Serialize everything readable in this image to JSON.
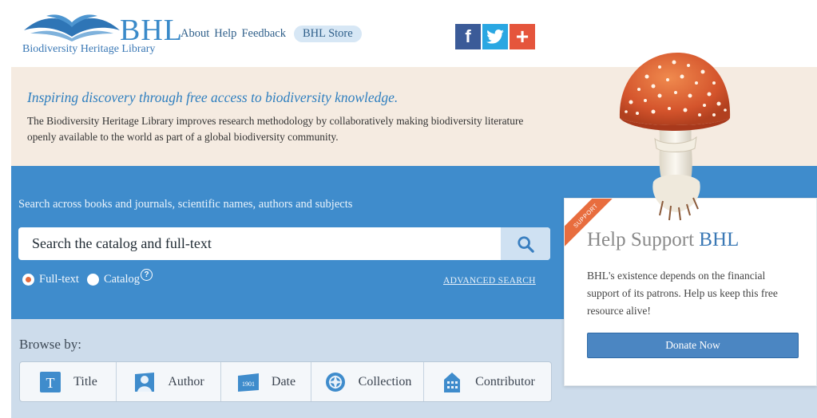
{
  "header": {
    "logo_text": "BHL",
    "logo_subtitle": "Biodiversity Heritage Library",
    "nav": {
      "about": "About",
      "help": "Help",
      "feedback": "Feedback",
      "store": "BHL Store"
    },
    "social": {
      "facebook": "f",
      "twitter_icon": "twitter-icon",
      "plus": "+"
    }
  },
  "banner": {
    "tagline": "Inspiring discovery through free access to biodiversity knowledge.",
    "description": "The Biodiversity Heritage Library improves research methodology by collaboratively making biodiversity literature openly available to the world as part of a global biodiversity community."
  },
  "search": {
    "caption": "Search across books and journals, scientific names, authors and subjects",
    "placeholder": "Search the catalog and full-text",
    "options": [
      {
        "label": "Full-text",
        "checked": true
      },
      {
        "label": "Catalog",
        "checked": false
      }
    ],
    "help_glyph": "?",
    "advanced": "ADVANCED SEARCH"
  },
  "browse": {
    "label": "Browse by:",
    "items": [
      {
        "label": "Title",
        "icon": "title-icon"
      },
      {
        "label": "Author",
        "icon": "author-icon"
      },
      {
        "label": "Date",
        "icon": "date-icon",
        "glyph": "1901"
      },
      {
        "label": "Collection",
        "icon": "collection-icon"
      },
      {
        "label": "Contributor",
        "icon": "contributor-icon"
      }
    ],
    "title_glyph": "T"
  },
  "support": {
    "ribbon": "SUPPORT",
    "title_pre": "Help Support ",
    "title_accent": "BHL",
    "text": "BHL's existence depends on the financial support of its patrons. Help us keep this free resource alive!",
    "donate": "Donate Now"
  },
  "colors": {
    "brand_blue": "#3a8ac9",
    "search_bg": "#3f8ccc",
    "accent_orange": "#e86d3e",
    "banner_bg": "#f5ebe1"
  }
}
